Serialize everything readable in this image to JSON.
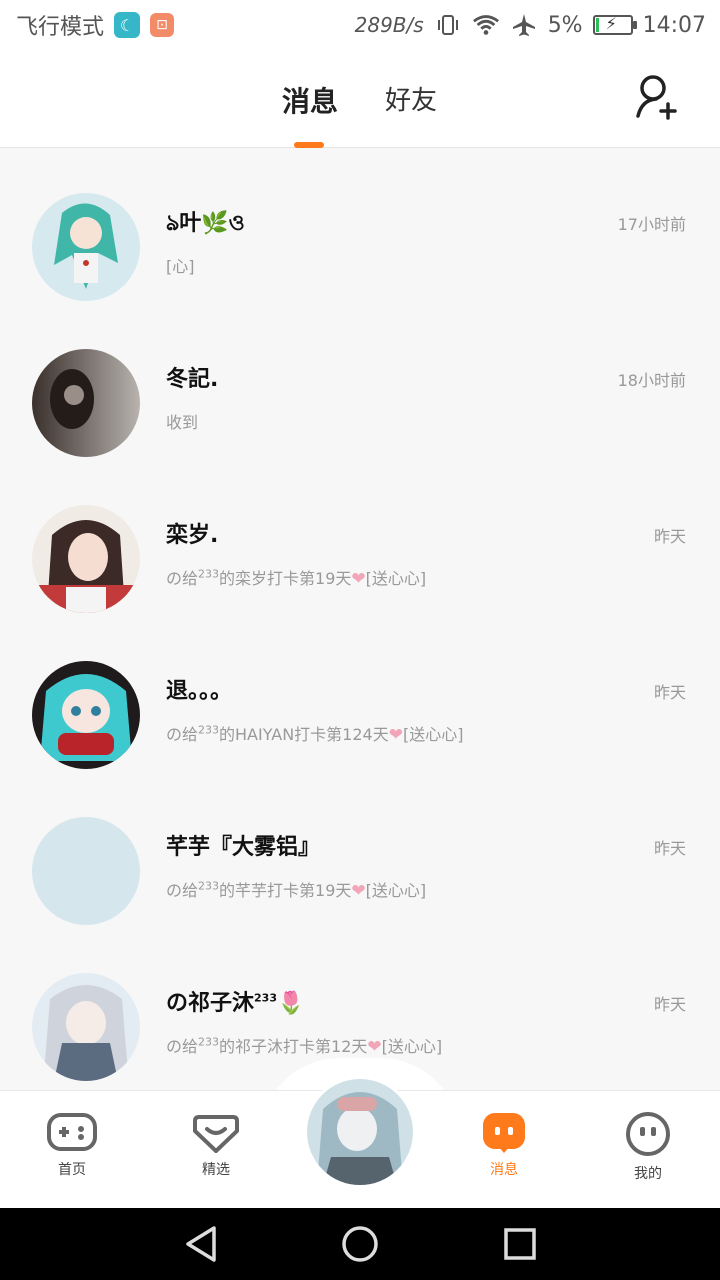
{
  "status_bar": {
    "carrier": "飞行模式",
    "speed": "289B/s",
    "battery": "5%",
    "time": "14:07",
    "icons": [
      "moon-icon",
      "bag-icon",
      "vibrate-icon",
      "wifi-icon",
      "airplane-icon",
      "battery-icon"
    ]
  },
  "header": {
    "tabs": [
      {
        "label": "消息",
        "active": true
      },
      {
        "label": "好友",
        "active": false
      }
    ],
    "add_friend_icon": "add-friend-icon",
    "accent": "#ff7a1a"
  },
  "conversations": [
    {
      "name": "ঌ叶🌿ও",
      "time": "17小时前",
      "preview": "[心]"
    },
    {
      "name": "冬記.",
      "time": "18小时前",
      "preview": "收到"
    },
    {
      "name": "栾岁.",
      "time": "昨天",
      "preview_a": "の给",
      "preview_sup": "233",
      "preview_b": "的栾岁打卡第19天",
      "preview_tail": "[送心心]"
    },
    {
      "name": "退。。。",
      "time": "昨天",
      "preview_a": "の给",
      "preview_sup": "233",
      "preview_b": "的HAIYAN打卡第124天",
      "preview_tail": "[送心心]"
    },
    {
      "name": "芊芋『大雾铝』",
      "time": "昨天",
      "preview_a": "の给",
      "preview_sup": "233",
      "preview_b": "的芊芋打卡第19天",
      "preview_tail": "[送心心]"
    },
    {
      "name_a": "の祁子沐",
      "name_sup": "233",
      "name_b": "🌷",
      "time": "昨天",
      "preview_a": "の给",
      "preview_sup": "233",
      "preview_b": "的祁子沐打卡第12天",
      "preview_tail": "[送心心]"
    }
  ],
  "bottom_nav": {
    "items": [
      {
        "label": "首页",
        "icon": "gamepad-icon"
      },
      {
        "label": "精选",
        "icon": "heart-chat-icon"
      },
      {
        "label": "消息",
        "icon": "message-icon",
        "active": true
      },
      {
        "label": "我的",
        "icon": "face-icon"
      }
    ]
  }
}
